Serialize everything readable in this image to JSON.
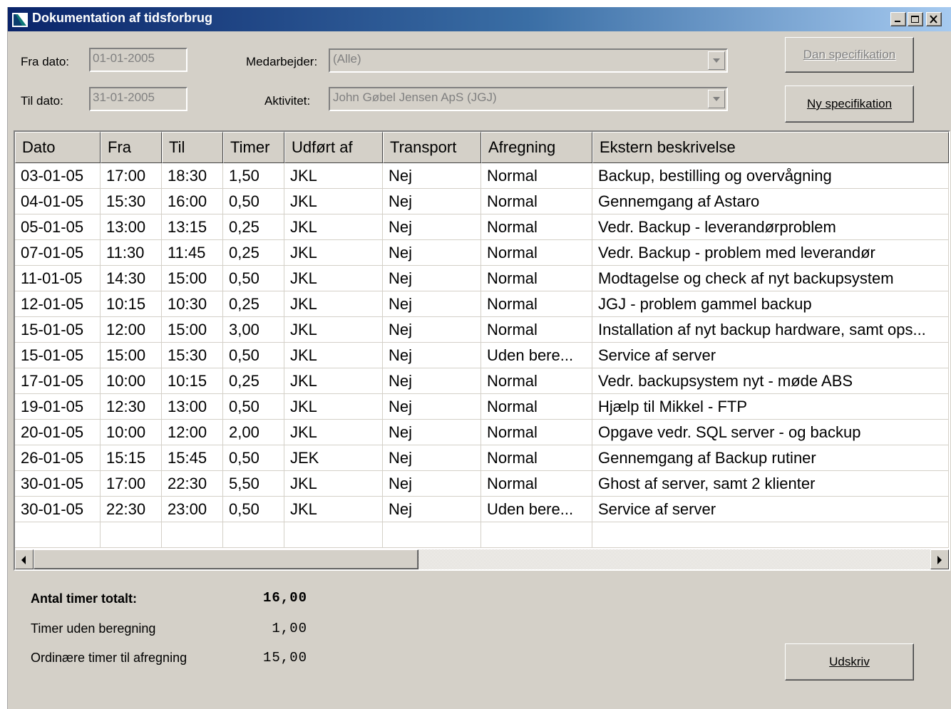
{
  "window": {
    "title": "Dokumentation af tidsforbrug"
  },
  "filters": {
    "fra_label": "Fra dato:",
    "fra_value": "01-01-2005",
    "til_label": "Til dato:",
    "til_value": "31-01-2005",
    "medarbejder_label": "Medarbejder:",
    "medarbejder_value": "(Alle)",
    "aktivitet_label": "Aktivitet:",
    "aktivitet_value": "John Gøbel Jensen ApS   (JGJ)"
  },
  "buttons": {
    "dan": "Dan specifikation",
    "ny": "Ny specifikation",
    "udskriv": "Udskriv"
  },
  "table": {
    "columns": [
      "Dato",
      "Fra",
      "Til",
      "Timer",
      "Udført af",
      "Transport",
      "Afregning",
      "Ekstern beskrivelse"
    ],
    "rows": [
      [
        "03-01-05",
        "17:00",
        "18:30",
        "1,50",
        "JKL",
        "Nej",
        "Normal",
        "Backup, bestilling og overvågning"
      ],
      [
        "04-01-05",
        "15:30",
        "16:00",
        "0,50",
        "JKL",
        "Nej",
        "Normal",
        "Gennemgang af Astaro"
      ],
      [
        "05-01-05",
        "13:00",
        "13:15",
        "0,25",
        "JKL",
        "Nej",
        "Normal",
        "Vedr. Backup - leverandørproblem"
      ],
      [
        "07-01-05",
        "11:30",
        "11:45",
        "0,25",
        "JKL",
        "Nej",
        "Normal",
        "Vedr. Backup - problem med leverandør"
      ],
      [
        "11-01-05",
        "14:30",
        "15:00",
        "0,50",
        "JKL",
        "Nej",
        "Normal",
        "Modtagelse og check af nyt backupsystem"
      ],
      [
        "12-01-05",
        "10:15",
        "10:30",
        "0,25",
        "JKL",
        "Nej",
        "Normal",
        "JGJ - problem gammel backup"
      ],
      [
        "15-01-05",
        "12:00",
        "15:00",
        "3,00",
        "JKL",
        "Nej",
        "Normal",
        "Installation af nyt backup hardware, samt ops..."
      ],
      [
        "15-01-05",
        "15:00",
        "15:30",
        "0,50",
        "JKL",
        "Nej",
        "Uden bere...",
        "Service af server"
      ],
      [
        "17-01-05",
        "10:00",
        "10:15",
        "0,25",
        "JKL",
        "Nej",
        "Normal",
        "Vedr. backupsystem nyt - møde ABS"
      ],
      [
        "19-01-05",
        "12:30",
        "13:00",
        "0,50",
        "JKL",
        "Nej",
        "Normal",
        "Hjælp til Mikkel - FTP"
      ],
      [
        "20-01-05",
        "10:00",
        "12:00",
        "2,00",
        "JKL",
        "Nej",
        "Normal",
        "Opgave vedr. SQL server - og backup"
      ],
      [
        "26-01-05",
        "15:15",
        "15:45",
        "0,50",
        "JEK",
        "Nej",
        "Normal",
        "Gennemgang af Backup rutiner"
      ],
      [
        "30-01-05",
        "17:00",
        "22:30",
        "5,50",
        "JKL",
        "Nej",
        "Normal",
        "Ghost af server, samt 2 klienter"
      ],
      [
        "30-01-05",
        "22:30",
        "23:00",
        "0,50",
        "JKL",
        "Nej",
        "Uden bere...",
        "Service af server"
      ]
    ]
  },
  "summary": {
    "total_label": "Antal timer totalt:",
    "total_value": "16,00",
    "uden_label": "Timer uden beregning",
    "uden_value": "1,00",
    "ordinaer_label": "Ordinære timer til afregning",
    "ordinaer_value": "15,00"
  }
}
